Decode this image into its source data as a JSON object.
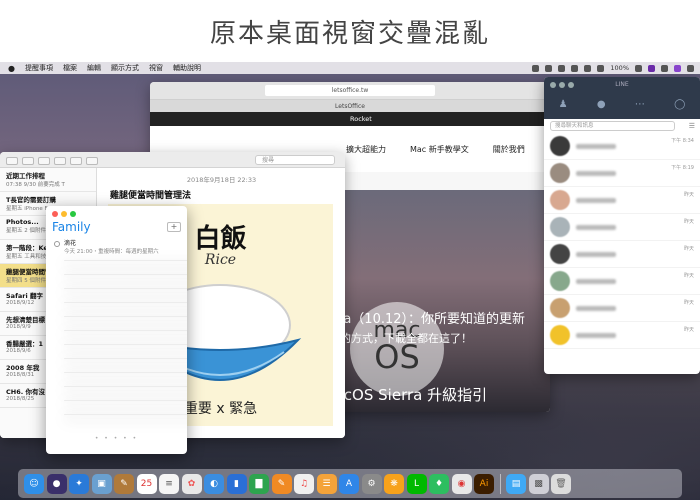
{
  "page": {
    "heading": "原本桌面視窗交疊混亂"
  },
  "menubar": {
    "apple": "",
    "items": [
      "提醒事項",
      "檔案",
      "編輯",
      "顯示方式",
      "視窗",
      "輔助說明"
    ],
    "battery": "100%"
  },
  "browser": {
    "url": "letsoffice.tw",
    "tab": "LetsOffice",
    "rocket": "Rocket",
    "nav": [
      "擴大超能力",
      "Mac 新手教學文",
      "關於我們"
    ],
    "macos_top": "mac",
    "macos_bottom": "OS",
    "hero_line1": "ra（10.12）：你所要知道的更新",
    "hero_line2": "的方式，下載全都在這了！",
    "hero_title": "macOS Sierra 升級指引"
  },
  "notes": {
    "search_placeholder": "搜尋",
    "items": [
      {
        "title": "近期工作排程",
        "sub": "07:38  9/30 前要完成 T"
      },
      {
        "title": "T長官的需要訂購",
        "sub": "星期五  iPhone For Tel"
      },
      {
        "title": "Photos...",
        "sub": "星期五  2 個附件"
      },
      {
        "title": "第一階段：Keynote...",
        "sub": "星期五  工具和技術"
      },
      {
        "title": "雞腿便當時間管理法",
        "sub": "星期四  5 個附件"
      },
      {
        "title": "Safari 翻字",
        "sub": "2018/9/12"
      },
      {
        "title": "先想清楚目標",
        "sub": "2018/9/9"
      },
      {
        "title": "香腸嚴選：1",
        "sub": "2018/9/6"
      },
      {
        "title": "2008 年我",
        "sub": "2018/8/31"
      },
      {
        "title": "CH6. 你有沒",
        "sub": "2018/8/25"
      }
    ],
    "date": "2018年9月18日 22:33",
    "title": "雞腿便當時間管理法",
    "card_zh": "白飯",
    "card_en": "Rice",
    "card_caption": "重要 x 緊急"
  },
  "family": {
    "title": "Family",
    "add": "+",
    "reminder": "滴花",
    "reminder_sub": "今天 21:00・重複時間：每週的星期六",
    "pager": "• • • • •"
  },
  "line": {
    "title": "LINE",
    "search_placeholder": "搜尋聊天和訊息",
    "times": [
      "下午 8:34",
      "下午 8:19",
      "昨天",
      "昨天",
      "昨天",
      "昨天",
      "昨天",
      "昨天"
    ]
  },
  "dock": {
    "icons": [
      "finder-icon",
      "siri-icon",
      "safari-icon",
      "preview-icon",
      "notes-icon",
      "calendar-icon",
      "reminders-icon",
      "photos-icon",
      "chrome-icon",
      "keynote-icon",
      "numbers-icon",
      "pages-icon",
      "music-icon",
      "books-icon",
      "app-store-icon",
      "settings-icon",
      "butterfly-icon",
      "line-icon",
      "evernote-icon",
      "chrome2-icon",
      "illustrator-icon",
      "folder-icon",
      "finder-window-icon",
      "trash-icon"
    ]
  }
}
